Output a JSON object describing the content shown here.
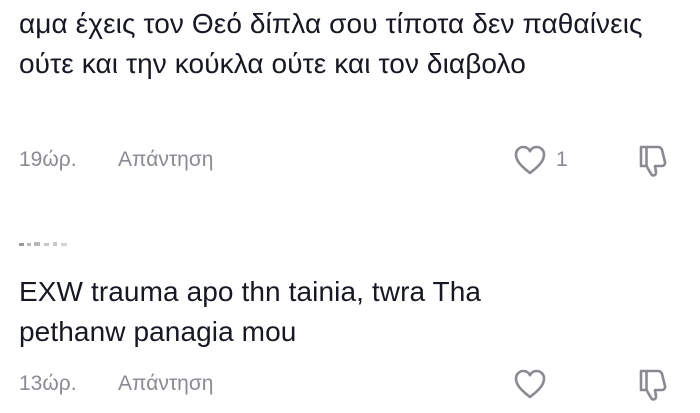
{
  "comments": [
    {
      "text": "αμα έχεις τον Θεό δίπλα σου τίποτα δεν παθαίνεις ούτε και την κούκλα ούτε και τον διαβολο",
      "timestamp": "19ώρ.",
      "reply_label": "Απάντηση",
      "like_count": "1"
    },
    {
      "text": "EXW trauma apo thn tainia, twra Tha pethanw panagia mou",
      "timestamp": "13ώρ.",
      "reply_label": "Απάντηση",
      "like_count": ""
    }
  ],
  "icons": {
    "like": "heart-outline-icon",
    "dislike": "thumbs-down-outline-icon"
  },
  "colors": {
    "text": "#161823",
    "secondary": "#8a8b91",
    "background": "#ffffff"
  }
}
